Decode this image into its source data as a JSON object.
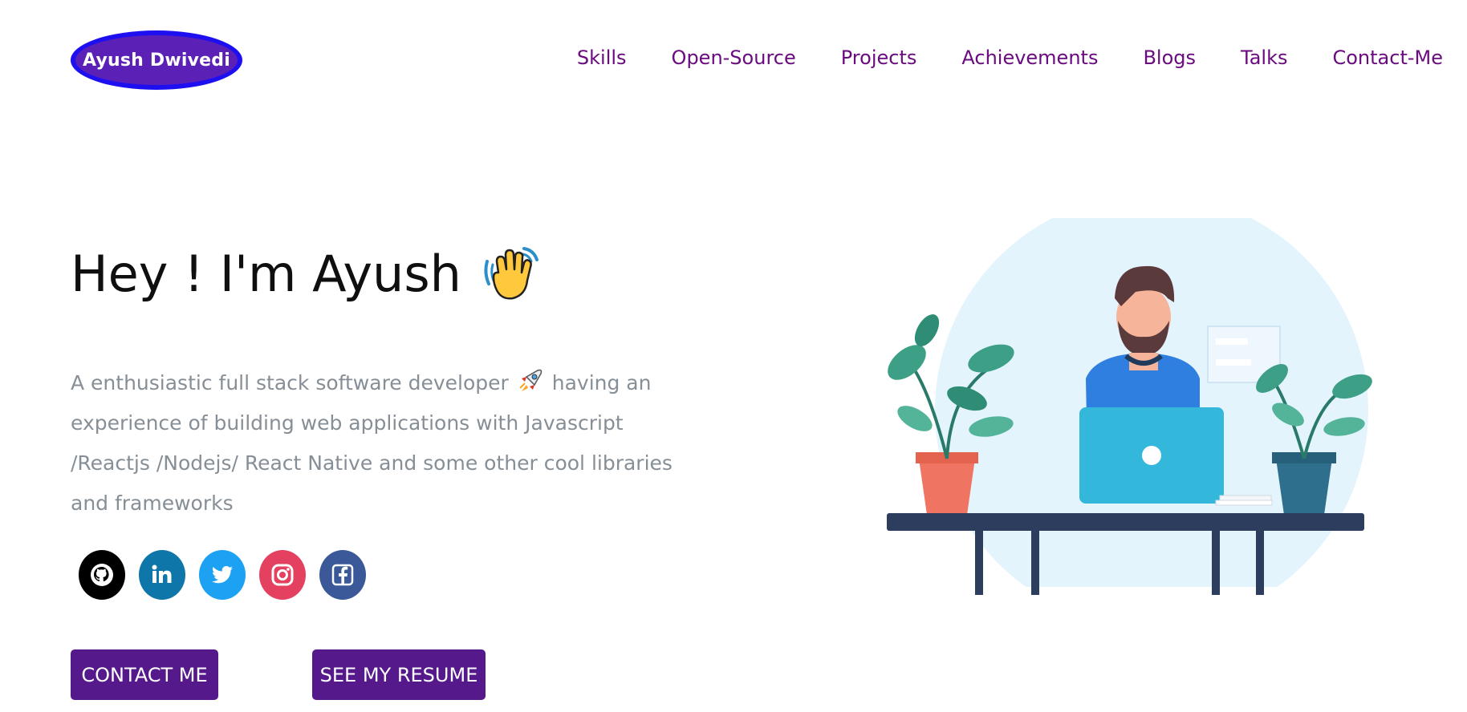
{
  "header": {
    "logo_text": "Ayush Dwivedi",
    "nav": [
      {
        "label": "Skills"
      },
      {
        "label": "Open-Source"
      },
      {
        "label": "Projects"
      },
      {
        "label": "Achievements"
      },
      {
        "label": "Blogs"
      },
      {
        "label": "Talks"
      },
      {
        "label": "Contact-Me"
      }
    ]
  },
  "hero": {
    "greeting": "Hey ! I'm Ayush",
    "greeting_icon": "waving-hand-icon",
    "intro_before_icon": "A enthusiastic full stack software developer",
    "intro_icon": "rocket-icon",
    "intro_after_icon": " having an experience of building web applications with Javascript /Reactjs /Nodejs/ React Native and some other cool libraries and frameworks"
  },
  "socials": [
    {
      "name": "github-icon",
      "color": "#000000"
    },
    {
      "name": "linkedin-icon",
      "color": "#0e76a8"
    },
    {
      "name": "twitter-icon",
      "color": "#1da1f2"
    },
    {
      "name": "instagram-icon",
      "color": "#e4405f"
    },
    {
      "name": "facebook-icon",
      "color": "#3b5998"
    }
  ],
  "buttons": {
    "contact": "CONTACT ME",
    "resume": "SEE MY RESUME"
  },
  "colors": {
    "nav_text": "#6b0b80",
    "button_bg": "#55198b",
    "logo_bg": "#5b21b6",
    "logo_border": "#1e0ff0",
    "body_text": "#868e96"
  },
  "illustration": {
    "name": "developer-at-desk-illustration"
  }
}
